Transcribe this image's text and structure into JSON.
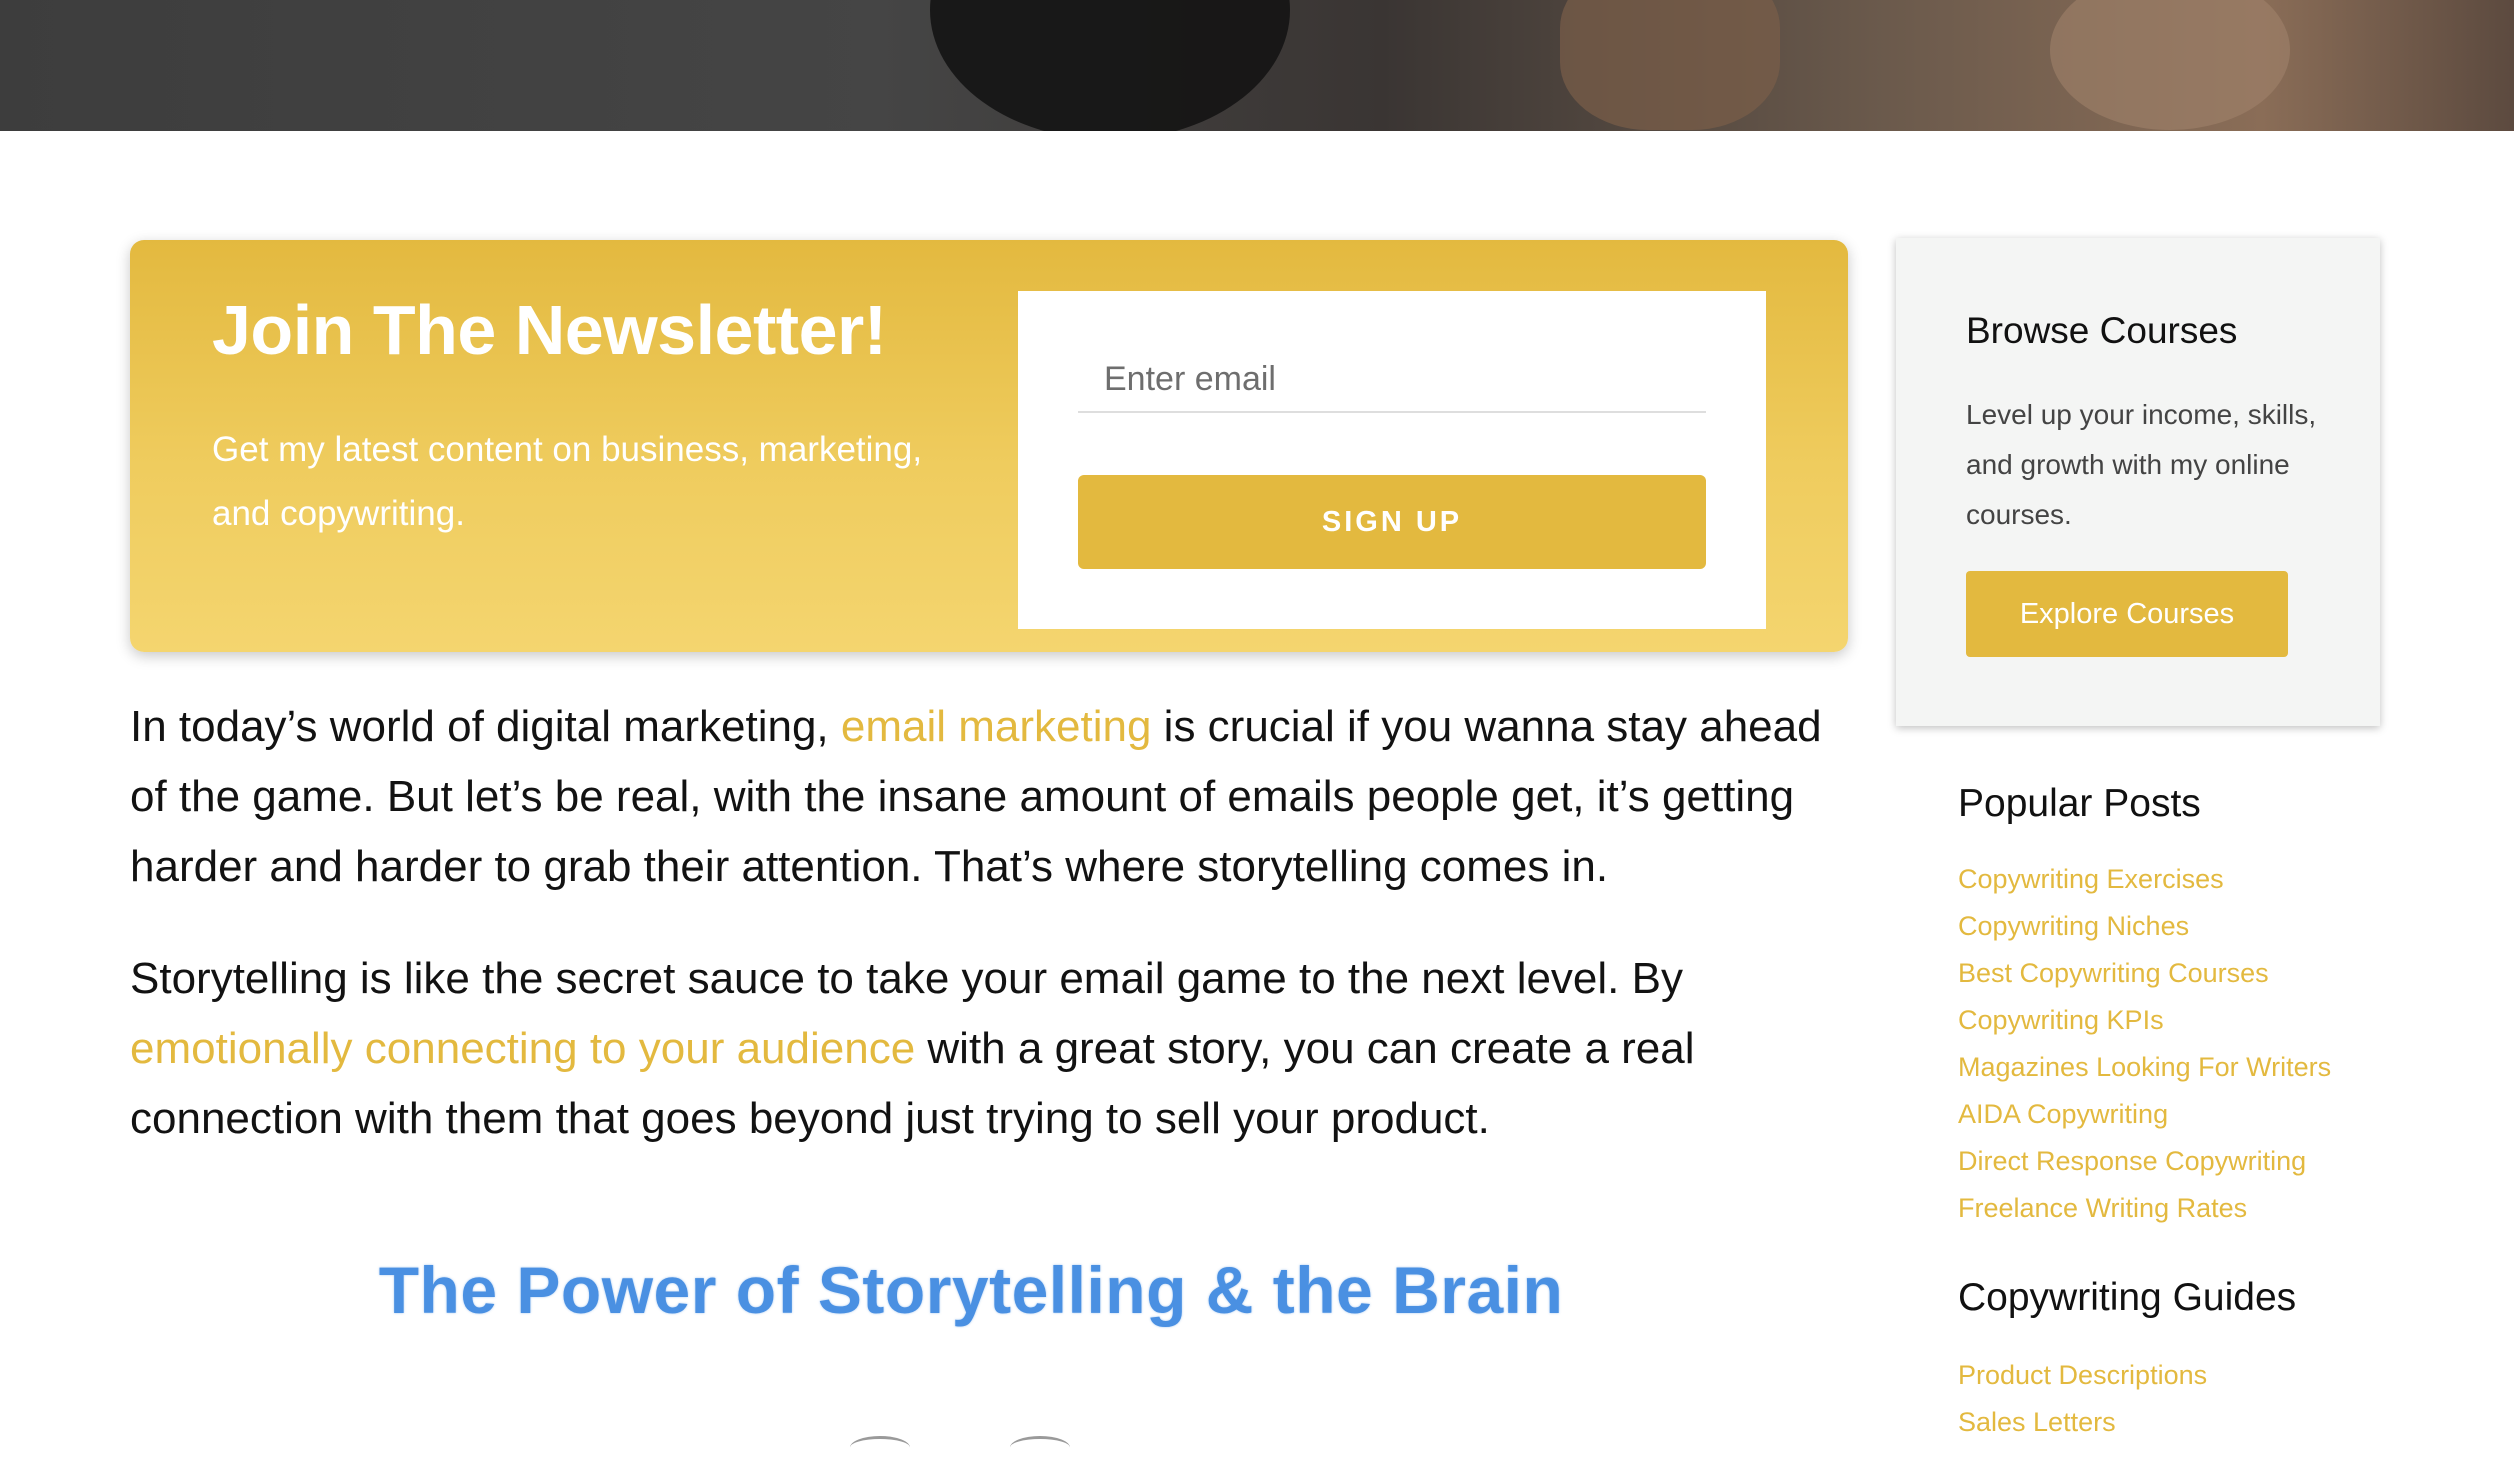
{
  "newsletter": {
    "title": "Join The Newsletter!",
    "description": "Get my latest content on business, marketing, and copywriting.",
    "email_placeholder": "Enter email",
    "signup_label": "SIGN UP"
  },
  "article": {
    "p1": {
      "before": "In today’s world of digital marketing, ",
      "link": "email marketing",
      "after": " is crucial if you wanna stay ahead of the game. But let’s be real, with the insane amount of emails people get, it’s getting harder and harder to grab their attention. That’s where storytelling comes in."
    },
    "p2": {
      "before": "Storytelling is like the secret sauce to take your email game to the next level. By ",
      "link": "emotionally connecting to your audience",
      "after": " with a great story, you can create a real connection with them that goes beyond just trying to sell your product."
    },
    "infographic_title": "The Power of Storytelling & the Brain"
  },
  "sidebar": {
    "courses": {
      "title": "Browse Courses",
      "description": "Level up your income, skills, and growth with my online courses.",
      "button_label": "Explore Courses"
    },
    "popular_posts": {
      "heading": "Popular Posts",
      "items": [
        "Copywriting Exercises",
        "Copywriting Niches",
        "Best Copywriting Courses",
        "Copywriting KPIs",
        "Magazines Looking For Writers",
        "AIDA Copywriting",
        "Direct Response Copywriting",
        "Freelance Writing Rates"
      ]
    },
    "copywriting_guides": {
      "heading": "Copywriting Guides",
      "items": [
        "Product Descriptions",
        "Sales Letters"
      ]
    }
  },
  "colors": {
    "accent": "#e3b93f",
    "infographic_blue": "#4a90e2",
    "text": "#121212"
  }
}
